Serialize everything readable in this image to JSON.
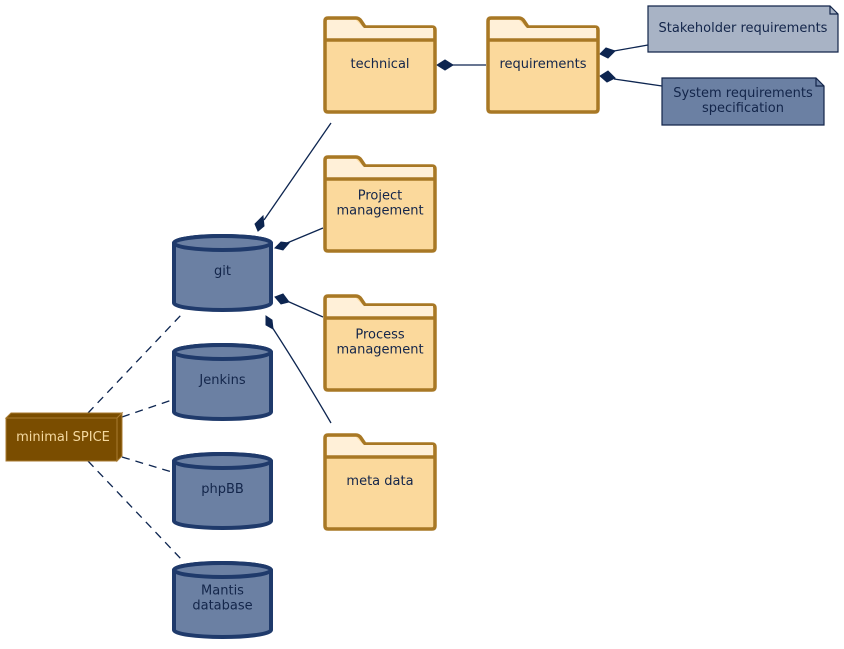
{
  "diagram": {
    "colors": {
      "node_fill": "#7a4d00",
      "node_top": "#a87a30",
      "node_text": "#f5d9a0",
      "db_fill": "#6b80a3",
      "db_stroke": "#1f3a6b",
      "db_text": "#13254a",
      "folder_fill": "#fbd99c",
      "folder_tab": "#fff0d8",
      "folder_stroke": "#a87825",
      "folder_text": "#13254a",
      "note1_fill": "#a8b3c5",
      "note2_fill": "#6b80a3",
      "note_stroke": "#13254a",
      "edge": "#0d2550"
    },
    "node": {
      "id": "minimal-spice",
      "label": "minimal SPICE"
    },
    "databases": [
      {
        "id": "git",
        "lines": [
          "git"
        ]
      },
      {
        "id": "jenkins",
        "lines": [
          "Jenkins"
        ]
      },
      {
        "id": "phpbb",
        "lines": [
          "phpBB"
        ]
      },
      {
        "id": "mantis",
        "lines": [
          "Mantis",
          "database"
        ]
      }
    ],
    "folders": [
      {
        "id": "technical",
        "lines": [
          "technical"
        ]
      },
      {
        "id": "requirements",
        "lines": [
          "requirements"
        ]
      },
      {
        "id": "project-management",
        "lines": [
          "Project",
          "management"
        ]
      },
      {
        "id": "process-management",
        "lines": [
          "Process",
          "management"
        ]
      },
      {
        "id": "meta-data",
        "lines": [
          "meta data"
        ]
      }
    ],
    "notes": [
      {
        "id": "stakeholder-requirements",
        "lines": [
          "Stakeholder requirements"
        ]
      },
      {
        "id": "system-requirements-specification",
        "lines": [
          "System requirements",
          "specification"
        ]
      }
    ],
    "edges": [
      {
        "from": "minimal-spice",
        "to": "git",
        "style": "dashed"
      },
      {
        "from": "minimal-spice",
        "to": "jenkins",
        "style": "dashed"
      },
      {
        "from": "minimal-spice",
        "to": "phpbb",
        "style": "dashed"
      },
      {
        "from": "minimal-spice",
        "to": "mantis",
        "style": "dashed"
      },
      {
        "from": "git",
        "to": "technical",
        "style": "composition"
      },
      {
        "from": "git",
        "to": "project-management",
        "style": "composition"
      },
      {
        "from": "git",
        "to": "process-management",
        "style": "composition"
      },
      {
        "from": "git",
        "to": "meta-data",
        "style": "composition"
      },
      {
        "from": "technical",
        "to": "requirements",
        "style": "composition"
      },
      {
        "from": "requirements",
        "to": "stakeholder-requirements",
        "style": "composition"
      },
      {
        "from": "requirements",
        "to": "system-requirements-specification",
        "style": "composition"
      }
    ]
  }
}
